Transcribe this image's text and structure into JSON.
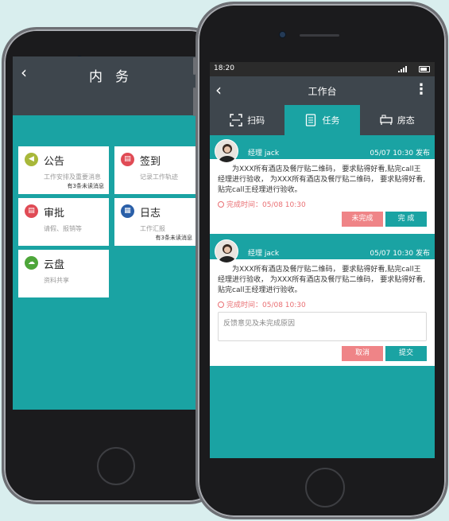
{
  "left_app": {
    "back_icon": "back-chevron-icon",
    "title": "内务",
    "cards": [
      {
        "name": "公告",
        "desc": "工作安排及重要消息",
        "note": "有3条未读消息",
        "icon": "megaphone-icon",
        "color": "#a8b83a"
      },
      {
        "name": "签到",
        "desc": "记录工作轨迹",
        "note": "",
        "icon": "checkin-icon",
        "color": "#e04b55"
      },
      {
        "name": "审批",
        "desc": "请假、报销等",
        "note": "",
        "icon": "approval-icon",
        "color": "#e04b55"
      },
      {
        "name": "日志",
        "desc": "工作汇报",
        "note": "有3条未读消息",
        "icon": "log-icon",
        "color": "#2a5fa8"
      },
      {
        "name": "云盘",
        "desc": "资料共享",
        "note": "",
        "icon": "cloud-icon",
        "color": "#4ea63a"
      }
    ]
  },
  "right_app": {
    "status_bar": {
      "time": "18:20"
    },
    "header": {
      "title": "工作台"
    },
    "tabs": [
      {
        "label": "扫码",
        "icon": "scan-icon",
        "active": false
      },
      {
        "label": "任务",
        "icon": "document-icon",
        "active": true
      },
      {
        "label": "房态",
        "icon": "bed-icon",
        "active": false
      }
    ],
    "tasks": [
      {
        "manager": "经理  jack",
        "date": "05/07  10:30 发布",
        "body": "为XXX所有酒店及餐厅贴二维码，  要求贴得好看,贴完call王经理进行验收，  为XXX所有酒店及餐厅贴二维码，  要求贴得好看,贴完call王经理进行验收。",
        "done_time": "完成时间：05/08 10:30",
        "btn_left": "未完成",
        "btn_right": "完 成"
      },
      {
        "manager": "经理  jack",
        "date": "05/07  10:30 发布",
        "body": "为XXX所有酒店及餐厅贴二维码，  要求贴得好看,贴完call王经理进行验收，  为XXX所有酒店及餐厅贴二维码，  要求贴得好看,贴完call王经理进行验收。",
        "done_time": "完成时间：05/08 10:30",
        "feedback_placeholder": "反馈意见及未完成原因",
        "btn_left": "取消",
        "btn_right": "提交"
      }
    ]
  },
  "colors": {
    "accent": "#1aa3a3",
    "header": "#3e464d",
    "warning": "#ef8487"
  }
}
